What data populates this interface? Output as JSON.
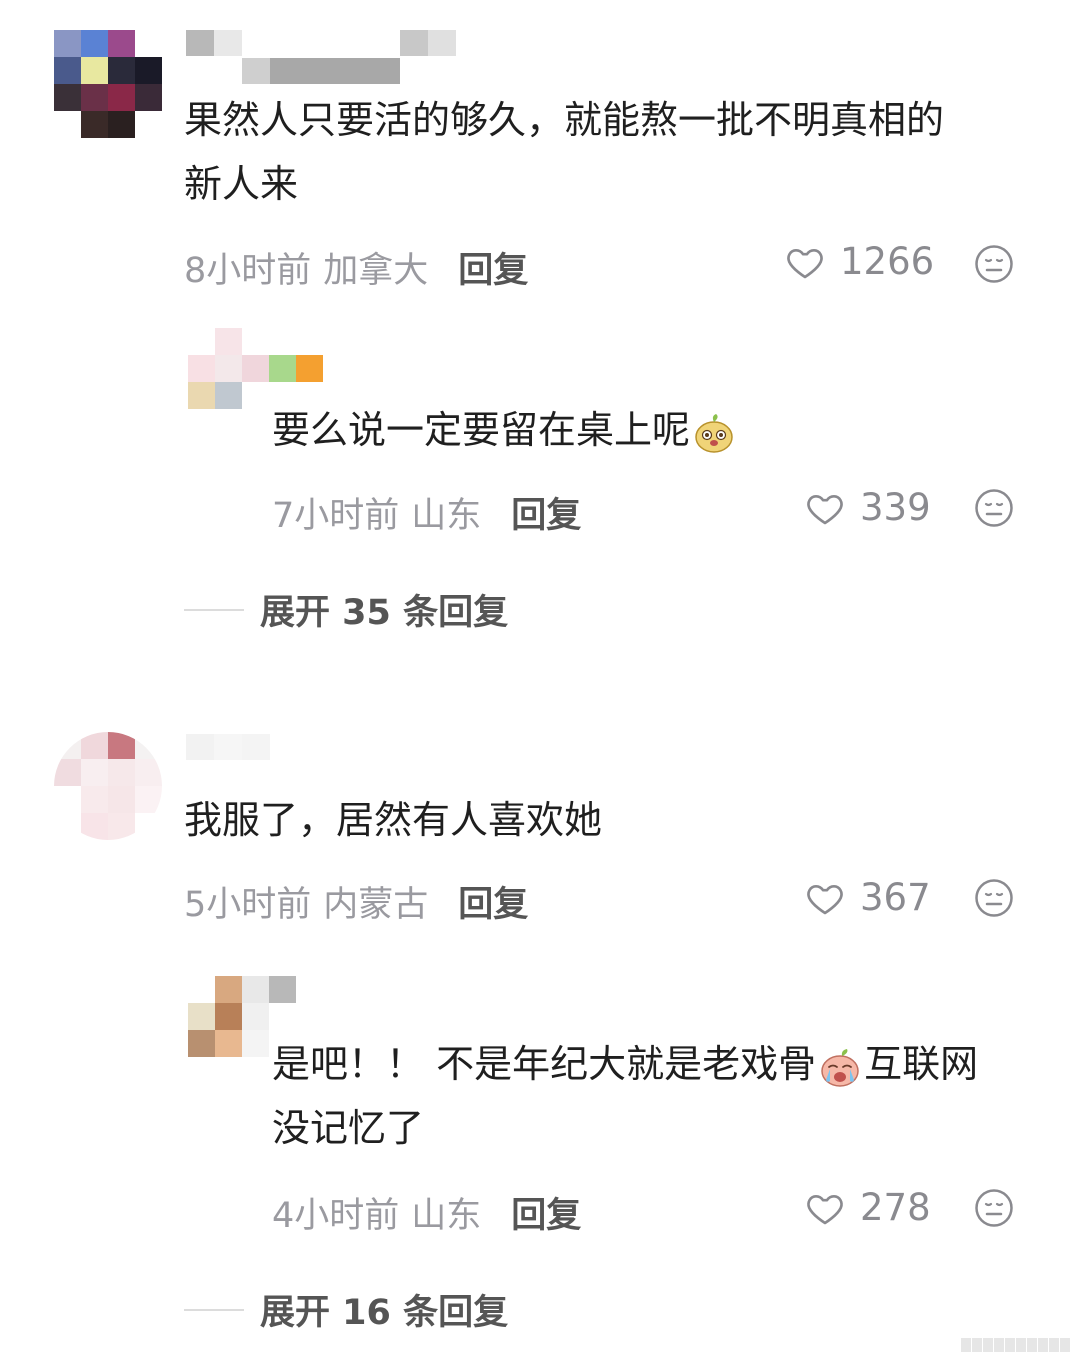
{
  "comments": [
    {
      "text_line1": "果然人只要活的够久，就能熬一批不明真相的",
      "text_line2": "新人来",
      "time": "8小时前",
      "location": "加拿大",
      "reply_label": "回复",
      "likes": "1266",
      "replies": [
        {
          "text_before_emoji": "要么说一定要留在桌上呢",
          "time": "7小时前",
          "location": "山东",
          "reply_label": "回复",
          "likes": "339"
        }
      ],
      "expand_label": "展开 35 条回复"
    },
    {
      "text_line1": "我服了，居然有人喜欢她",
      "time": "5小时前",
      "location": "内蒙古",
      "reply_label": "回复",
      "likes": "367",
      "replies": [
        {
          "text_line1_before_emoji": "是吧！！ 不是年纪大就是老戏骨",
          "text_line1_after_emoji": "互联网",
          "text_line2": "没记忆了",
          "time": "4小时前",
          "location": "山东",
          "reply_label": "回复",
          "likes": "278"
        }
      ],
      "expand_label": "展开 16 条回复"
    }
  ],
  "icons": {
    "like": "heart-outline-icon",
    "dislike": "neutral-face-icon"
  },
  "colors": {
    "meta_gray": "#9a9aa0",
    "text": "#1f1f1f"
  }
}
